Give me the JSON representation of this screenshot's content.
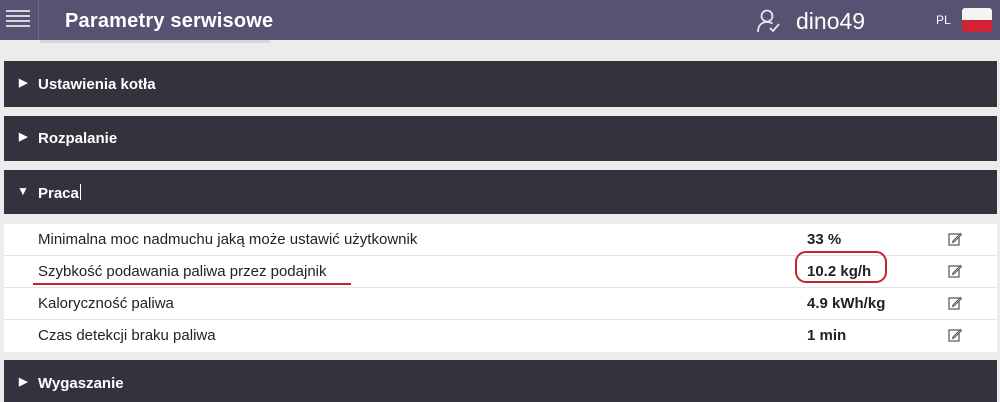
{
  "header": {
    "title": "Parametry serwisowe",
    "username": "dino49",
    "language": "PL"
  },
  "sections": {
    "s1": "Ustawienia kotła",
    "s2": "Rozpalanie",
    "s3": "Praca",
    "s4": "Wygaszanie"
  },
  "rows": [
    {
      "name": "Minimalna moc nadmuchu jaką może ustawić użytkownik",
      "value": "33 %"
    },
    {
      "name": "Szybkość podawania paliwa przez podajnik",
      "value": "10.2 kg/h"
    },
    {
      "name": "Kaloryczność paliwa",
      "value": "4.9 kWh/kg"
    },
    {
      "name": "Czas detekcji braku paliwa",
      "value": "1 min"
    }
  ],
  "colors": {
    "header_bg": "#575172",
    "section_bg": "#33333d",
    "annotation": "#c1272d"
  },
  "icons": {
    "menu": "menu-icon",
    "user": "user-icon",
    "flag": "poland-flag-icon",
    "collapsed": "triangle-right-icon",
    "expanded": "triangle-down-icon",
    "edit": "edit-icon"
  }
}
